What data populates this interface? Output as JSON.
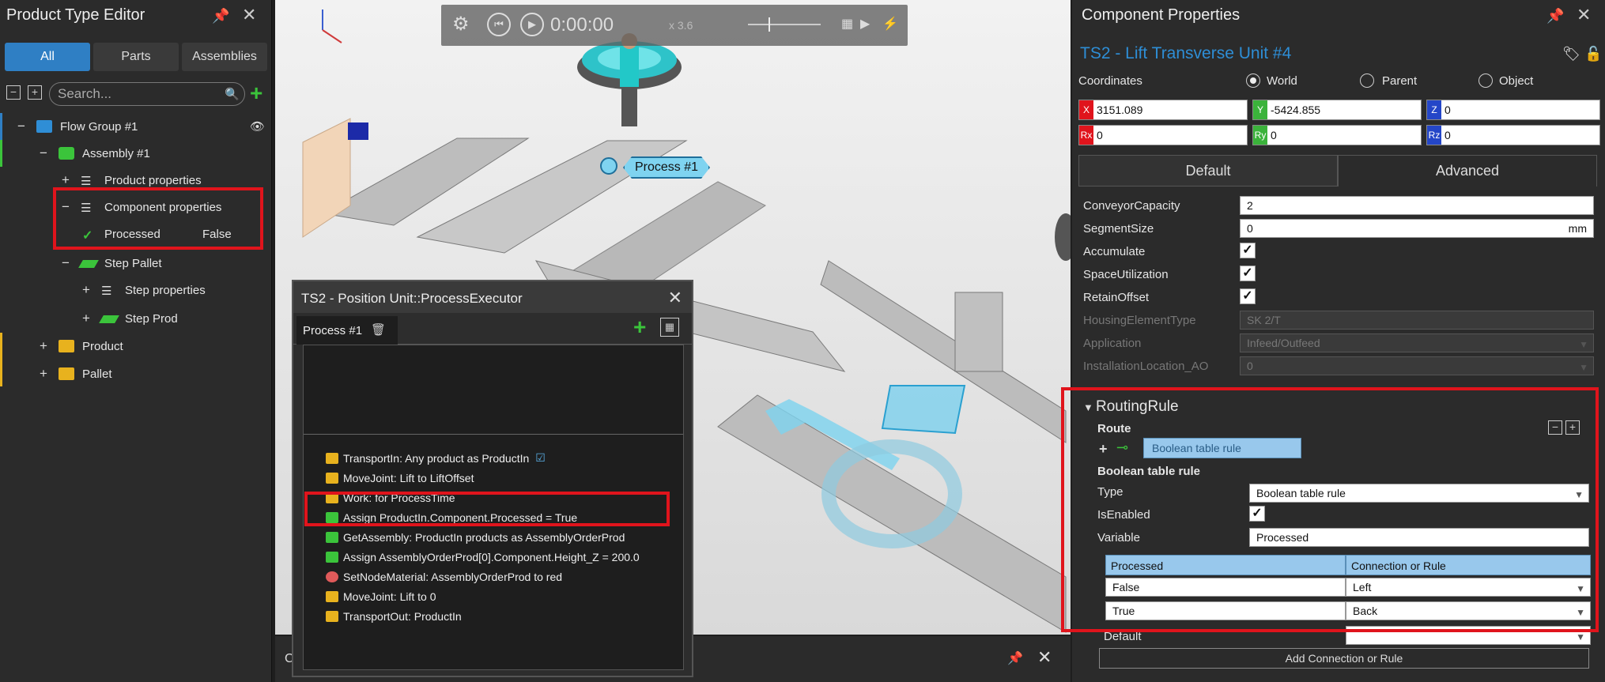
{
  "left_panel": {
    "title": "Product Type Editor",
    "tabs": [
      "All",
      "Parts",
      "Assemblies"
    ],
    "search_placeholder": "Search...",
    "tree": [
      {
        "label": "Flow Group #1"
      },
      {
        "label": "Assembly #1"
      },
      {
        "label": "Product properties"
      },
      {
        "label": "Component properties"
      },
      {
        "label": "Processed",
        "value": "False"
      },
      {
        "label": "Step Pallet"
      },
      {
        "label": "Step properties"
      },
      {
        "label": "Step Prod"
      },
      {
        "label": "Product"
      },
      {
        "label": "Pallet"
      }
    ]
  },
  "viewport": {
    "time": "0:00:00",
    "speed": "x 3.6",
    "process_tag": "Process #1"
  },
  "executor": {
    "title": "TS2 - Position Unit::ProcessExecutor",
    "tab": "Process #1",
    "steps": [
      "TransportIn: Any product as ProductIn",
      "MoveJoint: Lift to LiftOffset",
      "Work: for ProcessTime",
      "Assign ProductIn.Component.Processed = True",
      "GetAssembly: ProductIn products as AssemblyOrderProd",
      "Assign AssemblyOrderProd[0].Component.Height_Z = 200.0",
      "SetNodeMaterial: AssemblyOrderProd to red",
      "MoveJoint: Lift to 0",
      "TransportOut: ProductIn"
    ]
  },
  "bottom_strip": {
    "label": "C"
  },
  "right_panel": {
    "title": "Component Properties",
    "object_name": "TS2 - Lift Transverse Unit #4",
    "coordinates_label": "Coordinates",
    "radios": [
      "World",
      "Parent",
      "Object"
    ],
    "coords": {
      "x": "3151.089",
      "y": "-5424.855",
      "z": "0",
      "rx": "0",
      "ry": "0",
      "rz": "0"
    },
    "tabs": [
      "Default",
      "Advanced"
    ],
    "props": [
      {
        "name": "ConveyorCapacity",
        "value": "2"
      },
      {
        "name": "SegmentSize",
        "value": "0",
        "unit": "mm"
      },
      {
        "name": "Accumulate"
      },
      {
        "name": "SpaceUtilization"
      },
      {
        "name": "RetainOffset"
      },
      {
        "name": "HousingElementType",
        "value": "SK 2/T"
      },
      {
        "name": "Application",
        "value": "Infeed/Outfeed"
      },
      {
        "name": "InstallationLocation_AO",
        "value": "0"
      }
    ],
    "routing": {
      "title": "RoutingRule",
      "route_label": "Route",
      "route_item": "Boolean table rule",
      "section": "Boolean table rule",
      "type_label": "Type",
      "type_value": "Boolean table rule",
      "enabled_label": "IsEnabled",
      "variable_label": "Variable",
      "variable_value": "Processed",
      "table_headers": [
        "Processed",
        "Connection or Rule"
      ],
      "rows": [
        {
          "cond": "False",
          "conn": "Left"
        },
        {
          "cond": "True",
          "conn": "Back"
        }
      ],
      "default_label": "Default",
      "add_button": "Add Connection or Rule"
    }
  }
}
